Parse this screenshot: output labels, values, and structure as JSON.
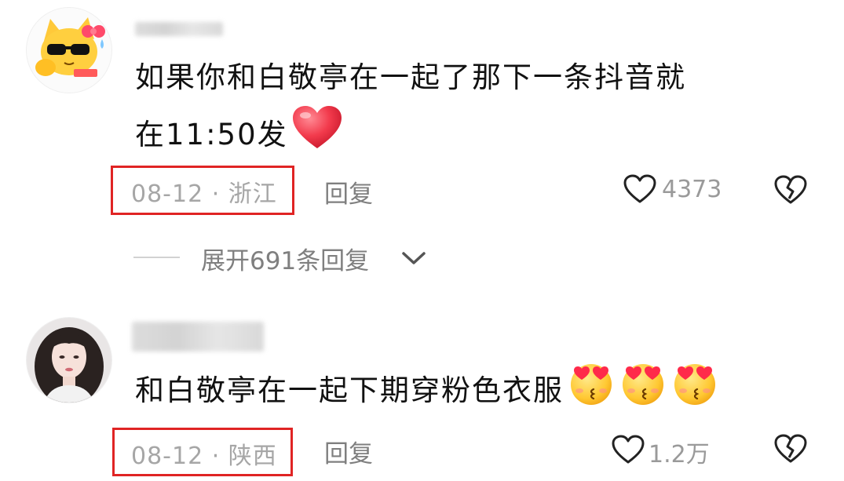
{
  "comments": [
    {
      "avatar_icon": "cartoon-cat-sunglasses-icon",
      "text_line1": "如果你和白敬亭在一起了那下一条抖音就",
      "text_line2": "在11:50发",
      "text_emoji": "red-heart-icon",
      "date_location": "08-12 · 浙江",
      "reply_label": "回复",
      "like_count": "4373",
      "expand_replies_label": "展开691条回复"
    },
    {
      "avatar_icon": "girl-portrait-avatar",
      "text_line1": "和白敬亭在一起下期穿粉色衣服",
      "text_emojis": [
        "heart-eyes-kiss-emoji",
        "heart-eyes-kiss-emoji",
        "heart-eyes-kiss-emoji"
      ],
      "date_location": "08-12 · 陕西",
      "reply_label": "回复",
      "like_count": "1.2万"
    }
  ],
  "colors": {
    "highlight_box": "#e02424",
    "meta_text": "#a6a6a6",
    "action_text": "#7f7f7f",
    "heart_red": "#f03a4f"
  }
}
